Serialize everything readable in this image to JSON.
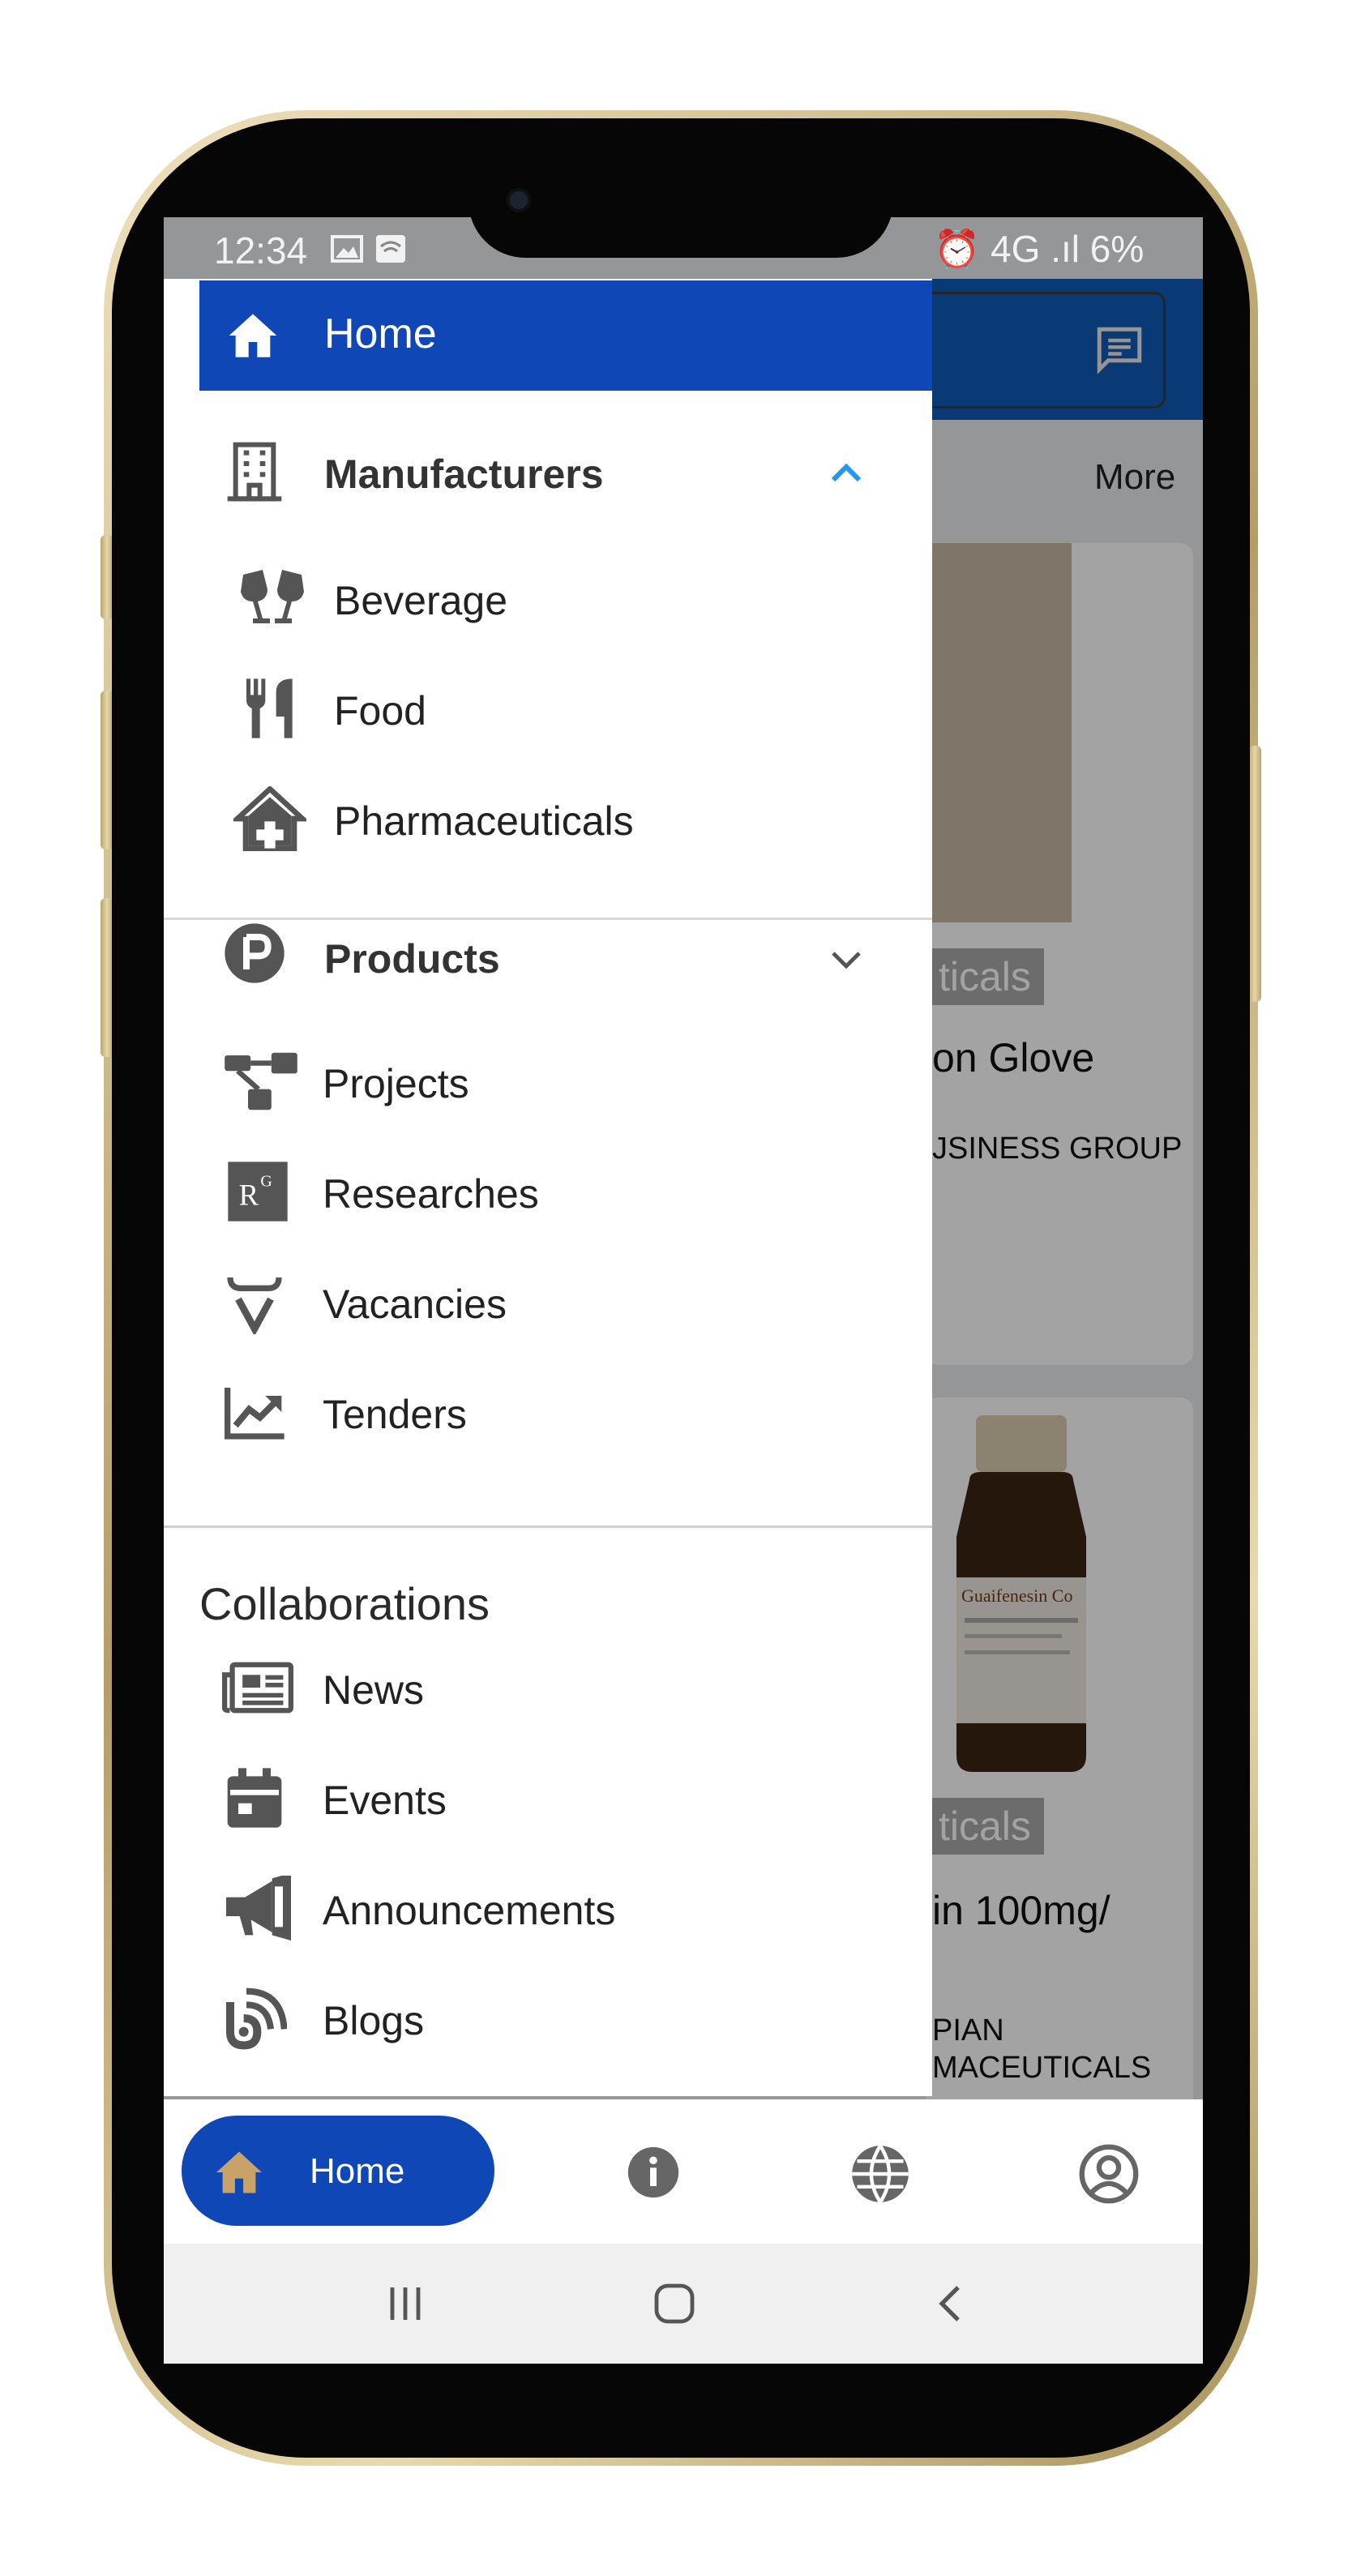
{
  "status_bar": {
    "time": "12:34",
    "right_text": "⏰ 4G .ıl 6%"
  },
  "drawer": {
    "home_label": "Home",
    "manufacturers": {
      "label": "Manufacturers",
      "items": [
        {
          "label": "Beverage",
          "icon": "glasses-cheers-icon"
        },
        {
          "label": "Food",
          "icon": "fork-knife-icon"
        },
        {
          "label": "Pharmaceuticals",
          "icon": "clinic-house-icon"
        }
      ]
    },
    "products": {
      "label": "Products",
      "items": [
        {
          "label": "Projects",
          "icon": "project-diagram-icon"
        },
        {
          "label": "Researches",
          "icon": "research-icon"
        },
        {
          "label": "Vacancies",
          "icon": "vacancy-icon"
        },
        {
          "label": "Tenders",
          "icon": "chart-line-icon"
        }
      ]
    },
    "collaborations": {
      "heading": "Collaborations",
      "items": [
        {
          "label": "News",
          "icon": "newspaper-icon"
        },
        {
          "label": "Events",
          "icon": "calendar-icon"
        },
        {
          "label": "Announcements",
          "icon": "megaphone-icon"
        },
        {
          "label": "Blogs",
          "icon": "blog-icon"
        }
      ]
    }
  },
  "background_app": {
    "more_label": "More",
    "card1": {
      "tag": "ticals",
      "title": "on Glove",
      "seller": "JSINESS GROUP"
    },
    "card2": {
      "tag": "ticals",
      "title": "in 100mg/",
      "seller_line1": "PIAN",
      "seller_line2": "MACEUTICALS",
      "bottle_label": "Guaifenesin Co"
    }
  },
  "bottom_nav": {
    "home_label": "Home",
    "icons": [
      "info-icon",
      "globe-icon",
      "account-icon"
    ]
  },
  "colors": {
    "accent_blue": "#1047b6",
    "appbar_blue": "#0f5cb8",
    "chevron_blue": "#2196f3",
    "icon_gray": "#555555"
  }
}
